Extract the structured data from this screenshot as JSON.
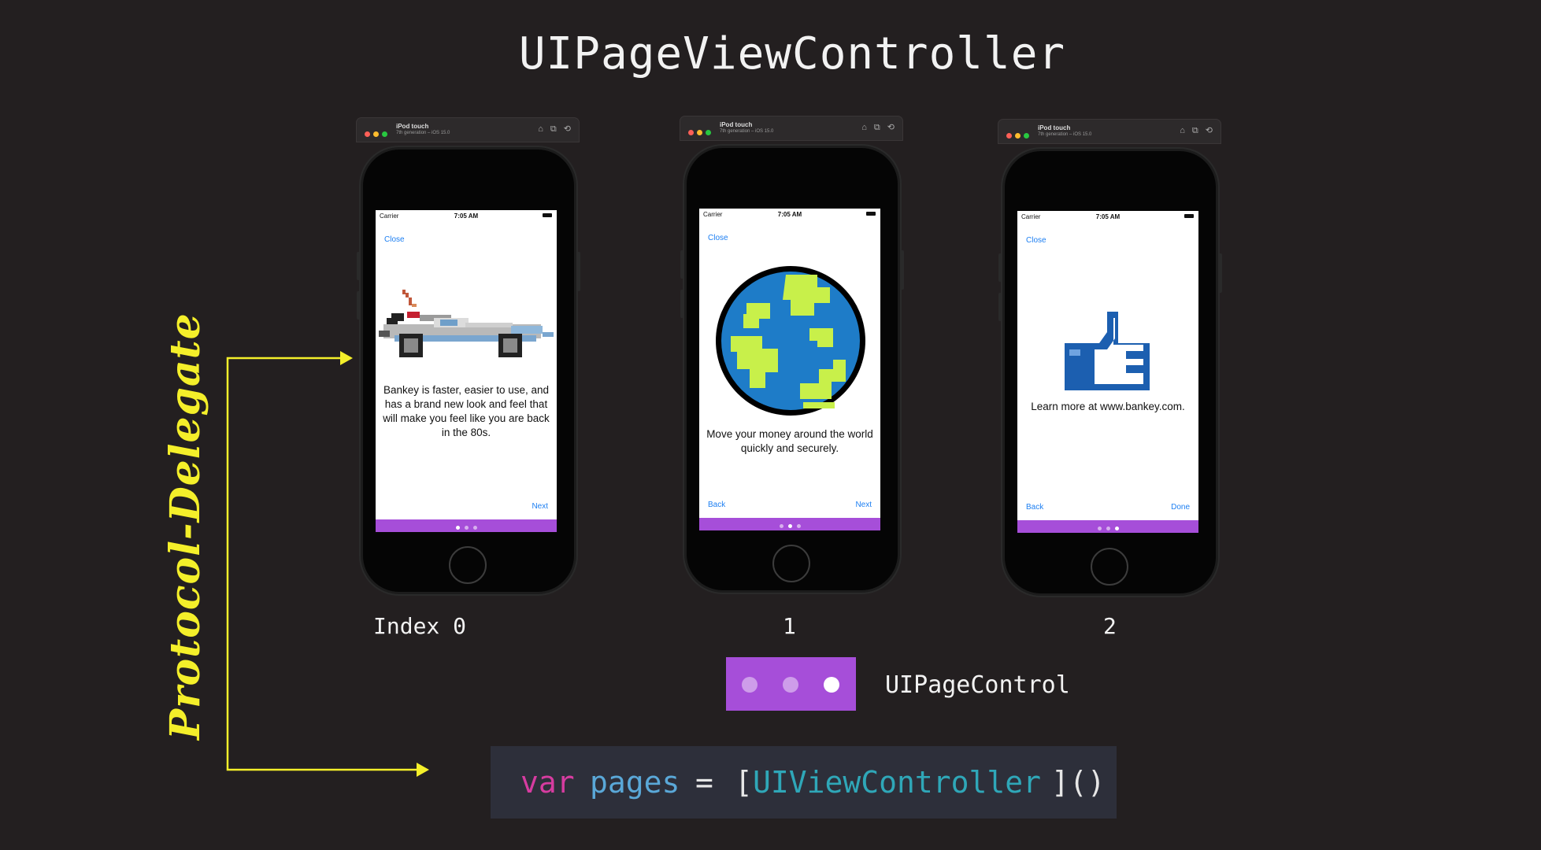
{
  "title": "UIPageViewController",
  "simulator": {
    "device": "iPod touch",
    "subtitle": "7th generation – iOS 15.0"
  },
  "status": {
    "carrier": "Carrier",
    "time": "7:05 AM"
  },
  "pages": [
    {
      "index_label": "Index  0",
      "close": "Close",
      "text": "Bankey is faster, easier to use, and has a brand new look and feel that will make you feel like you are back in the 80s.",
      "back": "",
      "next": "Next",
      "active_dot": 0,
      "image": "delorean-icon"
    },
    {
      "index_label": "1",
      "close": "Close",
      "text": "Move your money around the world quickly and securely.",
      "back": "Back",
      "next": "Next",
      "active_dot": 1,
      "image": "globe-icon"
    },
    {
      "index_label": "2",
      "close": "Close",
      "text": "Learn more at www.bankey.com.",
      "back": "Back",
      "next": "Done",
      "active_dot": 2,
      "image": "thumbs-up-icon"
    }
  ],
  "page_control": {
    "label": "UIPageControl",
    "active_dot": 2,
    "dot_count": 3
  },
  "code": {
    "keyword": "var",
    "name": "pages",
    "equals": "=",
    "open": "[",
    "type": "UIViewController",
    "close": "]()"
  },
  "side_label": "Protocol-Delegate",
  "colors": {
    "background": "#231f20",
    "accent_purple": "#a64ed9",
    "arrow_yellow": "#f4ef2a",
    "link_blue": "#1d7ff2",
    "code_keyword": "#d63ca0",
    "code_type": "#2fa7b8",
    "code_name": "#5aa8d8"
  }
}
